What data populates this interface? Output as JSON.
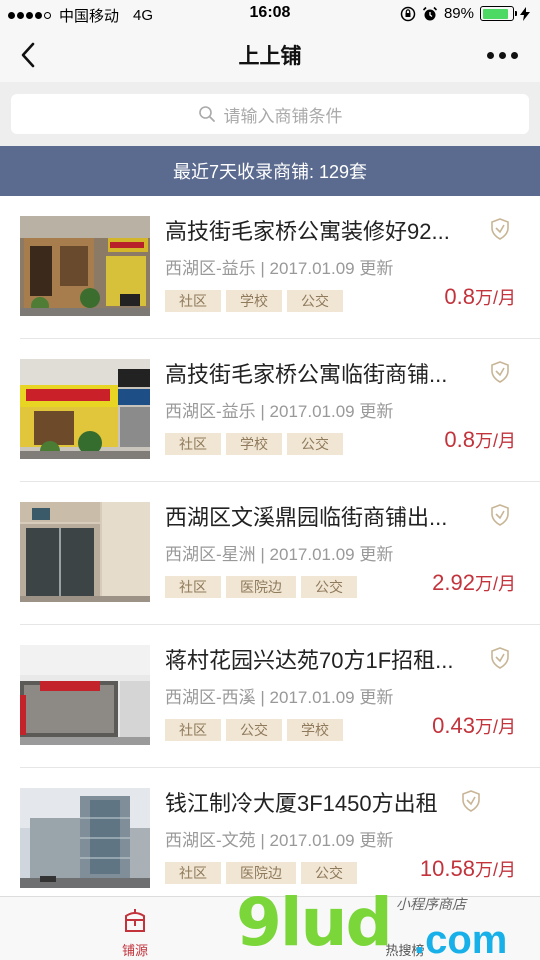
{
  "status_bar": {
    "carrier": "中国移动",
    "network": "4G",
    "time": "16:08",
    "battery_percent": "89%",
    "battery_level": 0.89
  },
  "nav": {
    "title": "上上铺"
  },
  "search": {
    "placeholder": "请输入商铺条件"
  },
  "banner": {
    "text": "最近7天收录商铺: 129套"
  },
  "listings": [
    {
      "title": "高技街毛家桥公寓装修好92...",
      "district": "西湖区-益乐",
      "date": "2017.01.09",
      "updated": "更新",
      "tags": [
        "社区",
        "学校",
        "公交"
      ],
      "price": "0.8",
      "unit": "万/月"
    },
    {
      "title": "高技街毛家桥公寓临街商铺...",
      "district": "西湖区-益乐",
      "date": "2017.01.09",
      "updated": "更新",
      "tags": [
        "社区",
        "学校",
        "公交"
      ],
      "price": "0.8",
      "unit": "万/月"
    },
    {
      "title": "西湖区文溪鼎园临街商铺出...",
      "district": "西湖区-星洲",
      "date": "2017.01.09",
      "updated": "更新",
      "tags": [
        "社区",
        "医院边",
        "公交"
      ],
      "price": "2.92",
      "unit": "万/月"
    },
    {
      "title": "蒋村花园兴达苑70方1F招租...",
      "district": "西湖区-西溪",
      "date": "2017.01.09",
      "updated": "更新",
      "tags": [
        "社区",
        "公交",
        "学校"
      ],
      "price": "0.43",
      "unit": "万/月"
    },
    {
      "title": "钱江制冷大厦3F1450方出租",
      "district": "西湖区-文苑",
      "date": "2017.01.09",
      "updated": "更新",
      "tags": [
        "社区",
        "医院边",
        "公交"
      ],
      "price": "10.58",
      "unit": "万/月"
    }
  ],
  "tabbar": {
    "tabs": [
      {
        "label": "铺源",
        "active": true
      },
      {
        "label": "热搜榜",
        "active": false
      }
    ]
  },
  "watermark": {
    "brand": "9lud",
    "suffix": ".com",
    "tagline": "小程序商店"
  },
  "colors": {
    "banner": "#5b6b8f",
    "price": "#c2333c",
    "tag_bg": "#f1e6d3",
    "tag_text": "#8f7a5c",
    "active_tab": "#c2333c"
  }
}
